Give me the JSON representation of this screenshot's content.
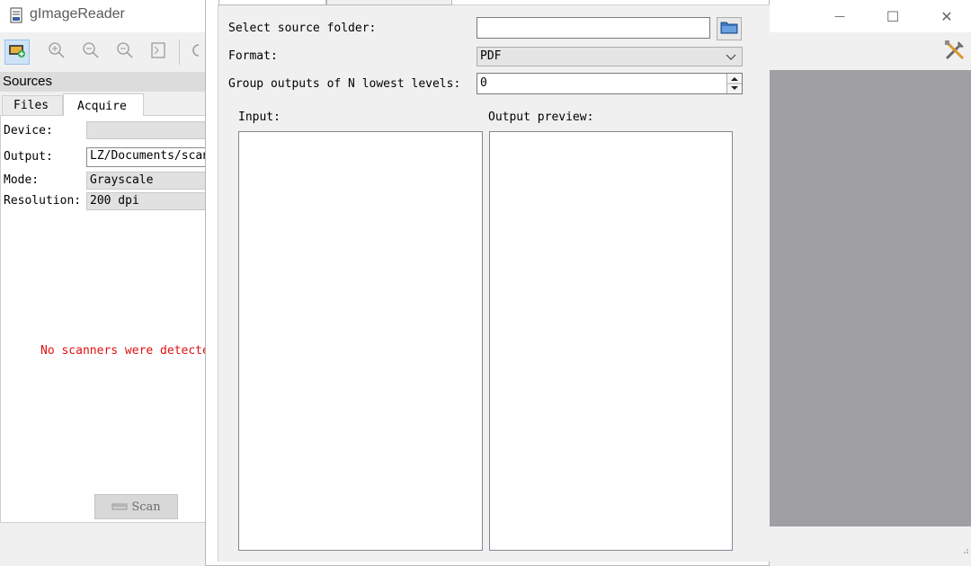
{
  "window": {
    "title": "gImageReader",
    "minimize_glyph": "—",
    "maximize_glyph": "☐",
    "close_glyph": "✕"
  },
  "toolbar": {
    "icons": [
      "acquire-image-icon",
      "zoom-in-icon",
      "zoom-out-icon",
      "zoom-original-icon",
      "zoom-fit-icon",
      "rotate-icon",
      "settings-tools-icon"
    ]
  },
  "sources": {
    "header": "Sources",
    "tabs": [
      "Files",
      "Acquire"
    ],
    "active_tab": "Acquire",
    "fields": {
      "device_label": "Device:",
      "device_value": "",
      "output_label": "Output:",
      "output_value": "LZ/Documents/scan",
      "mode_label": "Mode:",
      "mode_value": "Grayscale",
      "resolution_label": "Resolution:",
      "resolution_value": "200 dpi"
    },
    "message": "No scanners were detected",
    "scan_button": "Scan"
  },
  "dialog": {
    "select_folder_label": "Select source folder:",
    "select_folder_value": "",
    "format_label": "Format:",
    "format_value": "PDF",
    "group_label": "Group outputs of N lowest levels:",
    "group_value": "0",
    "input_label": "Input:",
    "output_preview_label": "Output preview:"
  },
  "colors": {
    "error_text": "#e01010",
    "canvas_bg": "#a0a0a4",
    "accent_folder": "#3a78c4"
  }
}
